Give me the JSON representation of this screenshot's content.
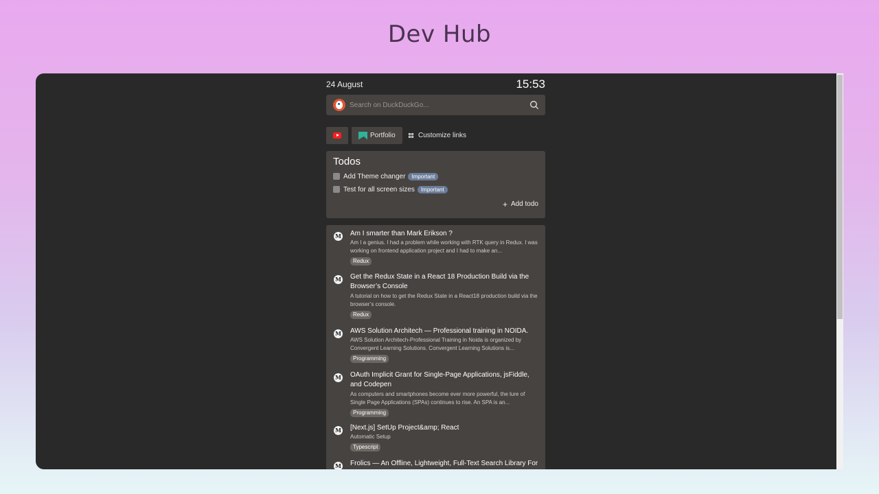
{
  "page": {
    "title": "Dev Hub"
  },
  "header": {
    "date": "24 August",
    "time": "15:53"
  },
  "search": {
    "placeholder": "Search on DuckDuckGo..."
  },
  "links": {
    "portfolio_label": "Portfolio",
    "customize_label": "Customize links"
  },
  "todos": {
    "title": "Todos",
    "items": [
      {
        "text": "Add Theme changer",
        "tag": "Important",
        "checked": false
      },
      {
        "text": "Test for all screen sizes",
        "tag": "Important",
        "checked": false
      }
    ],
    "add_label": "Add todo"
  },
  "articles": [
    {
      "title": "Am I smarter than Mark Erikson ?",
      "description": "Am I a genius. I had a problem while working with RTK query in Redux. I was working on frontend application project and I had to make an...",
      "tag": "Redux"
    },
    {
      "title": "Get the Redux State in a React 18 Production Build via the Browser’s Console",
      "description": "A tutorial on how to get the Redux State in a React18 production build via the browser’s console.",
      "tag": "Redux"
    },
    {
      "title": "AWS Solution Architech — Professional training in NOIDA.",
      "description": "AWS Solution Architech-Professional Training in Noida is organized by Convergent Learning Solutions. Convergent Learning Solutions is...",
      "tag": "Programming"
    },
    {
      "title": "OAuth Implicit Grant for Single-Page Applications, jsFiddle, and Codepen",
      "description": "As computers and smartphones become ever more powerful, the lure of Single Page Applications (SPAs) continues to rise. An SPA is an...",
      "tag": "Programming"
    },
    {
      "title": "[Next.js] SetUp Project&amp; React",
      "description": "Automatic Setup",
      "tag": "Typescript"
    },
    {
      "title": "Frolics — An Offline, Lightweight, Full-Text Search Library For",
      "description": "",
      "tag": ""
    }
  ],
  "colors": {
    "background_top": "#e9a9ee",
    "window": "#292929",
    "card": "#474340",
    "important_tag": "#6a7c99"
  },
  "icons": {
    "search_engine": "duckduckgo-icon",
    "video": "youtube-icon",
    "portfolio": "portfolio-icon",
    "customize": "grid-icon",
    "article_source": "medium-icon"
  }
}
